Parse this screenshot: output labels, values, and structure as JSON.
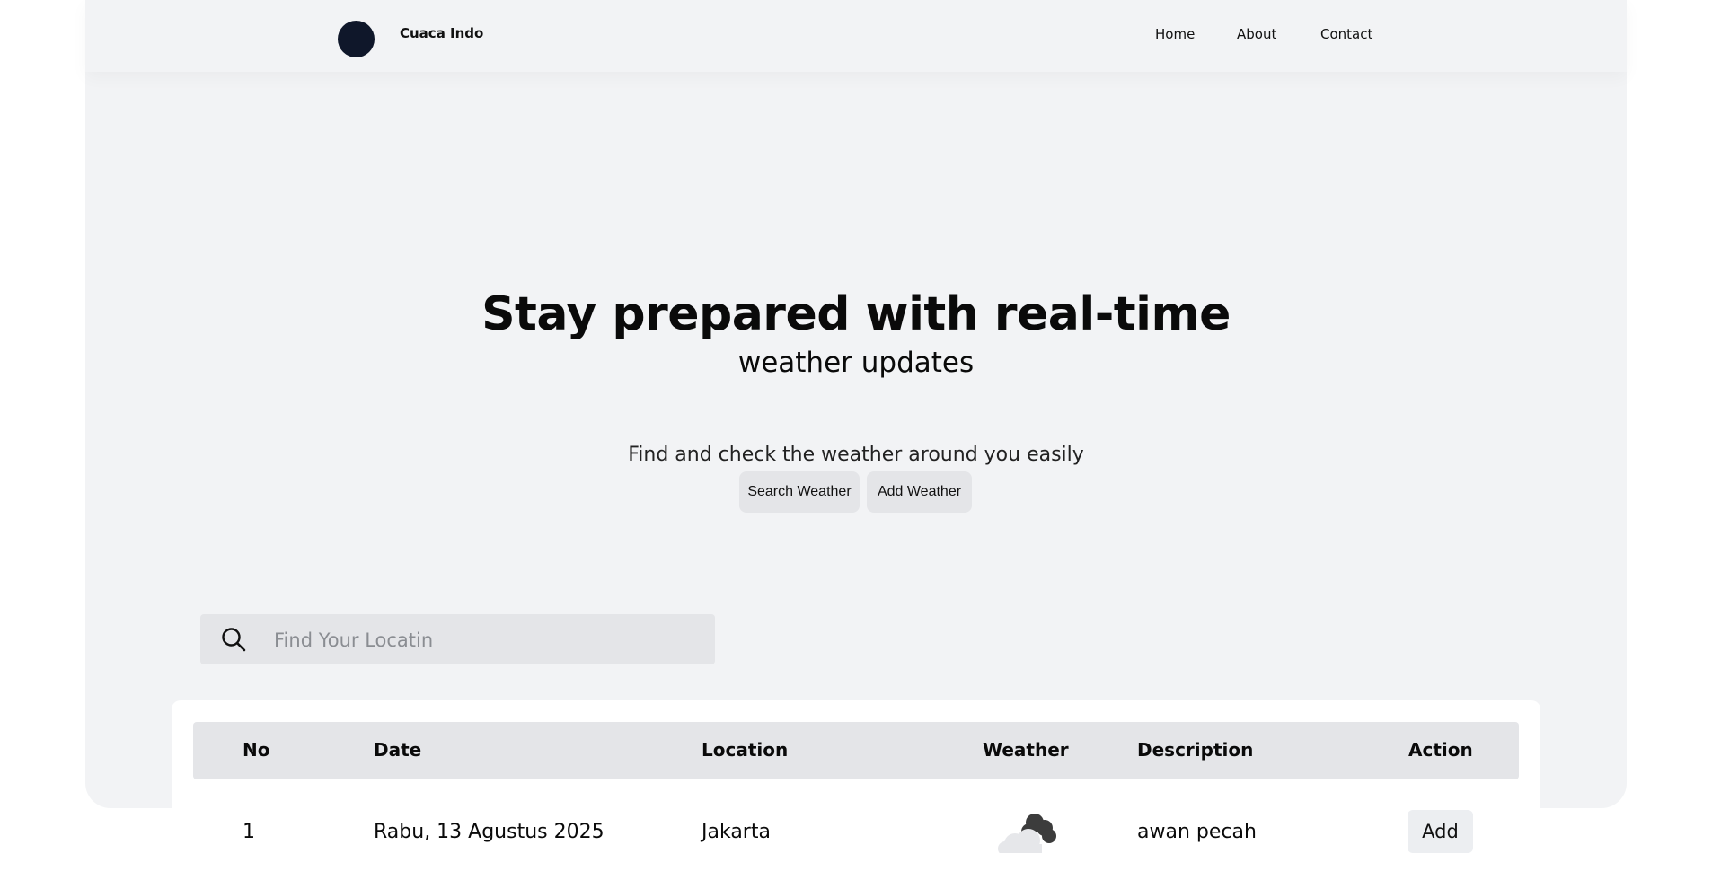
{
  "nav": {
    "brand": "Cuaca Indo",
    "links": [
      "Home",
      "About",
      "Contact"
    ]
  },
  "hero": {
    "title": "Stay prepared with real-time",
    "subtitle": "weather updates",
    "description": "Find and check the weather around you easily",
    "buttons": [
      "Search Weather",
      "Add Weather"
    ]
  },
  "search": {
    "placeholder": "Find Your Locatin",
    "icon": "search-icon"
  },
  "table": {
    "headers": [
      "No",
      "Date",
      "Location",
      "Weather",
      "Description",
      "Action"
    ],
    "rows": [
      {
        "no": "1",
        "date": "Rabu, 13 Agustus 2025",
        "location": "Jakarta",
        "weather_icon": "cloud-icon",
        "description": "awan pecah",
        "action": "Add"
      }
    ]
  },
  "colors": {
    "background": "#f2f3f5",
    "card": "#ffffff",
    "header_bg": "#e4e5e8",
    "logo": "#0f172a"
  }
}
